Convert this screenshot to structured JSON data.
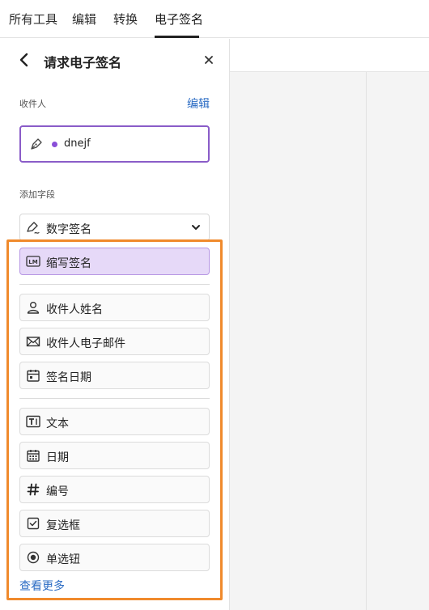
{
  "nav": {
    "tabs": [
      {
        "label": "所有工具"
      },
      {
        "label": "编辑"
      },
      {
        "label": "转换"
      },
      {
        "label": "电子签名"
      }
    ],
    "active_tab": "电子签名"
  },
  "panel": {
    "title": "请求电子签名",
    "recipients_label": "收件人",
    "edit_label": "编辑",
    "recipient": {
      "name": "dnejf",
      "dot_color": "#8a4fd8"
    },
    "add_fields_label": "添加字段",
    "dropdown": {
      "label": "数字签名",
      "icon": "signature-pen-icon"
    },
    "fields_group1": [
      {
        "label": "缩写签名",
        "icon": "initials-icon",
        "selected": true
      }
    ],
    "fields_group2": [
      {
        "label": "收件人姓名",
        "icon": "person-icon"
      },
      {
        "label": "收件人电子邮件",
        "icon": "envelope-icon"
      },
      {
        "label": "签名日期",
        "icon": "calendar-icon"
      }
    ],
    "fields_group3": [
      {
        "label": "文本",
        "icon": "text-field-icon"
      },
      {
        "label": "日期",
        "icon": "date-grid-icon"
      },
      {
        "label": "编号",
        "icon": "hash-icon"
      },
      {
        "label": "复选框",
        "icon": "checkbox-icon"
      },
      {
        "label": "单选钮",
        "icon": "radio-icon"
      }
    ],
    "see_more_label": "查看更多"
  },
  "colors": {
    "accent": "#2b6cc4",
    "selected_bg": "#e6d9f8",
    "recipient_border": "#8a5cc8",
    "highlight": "#f08a2c"
  }
}
